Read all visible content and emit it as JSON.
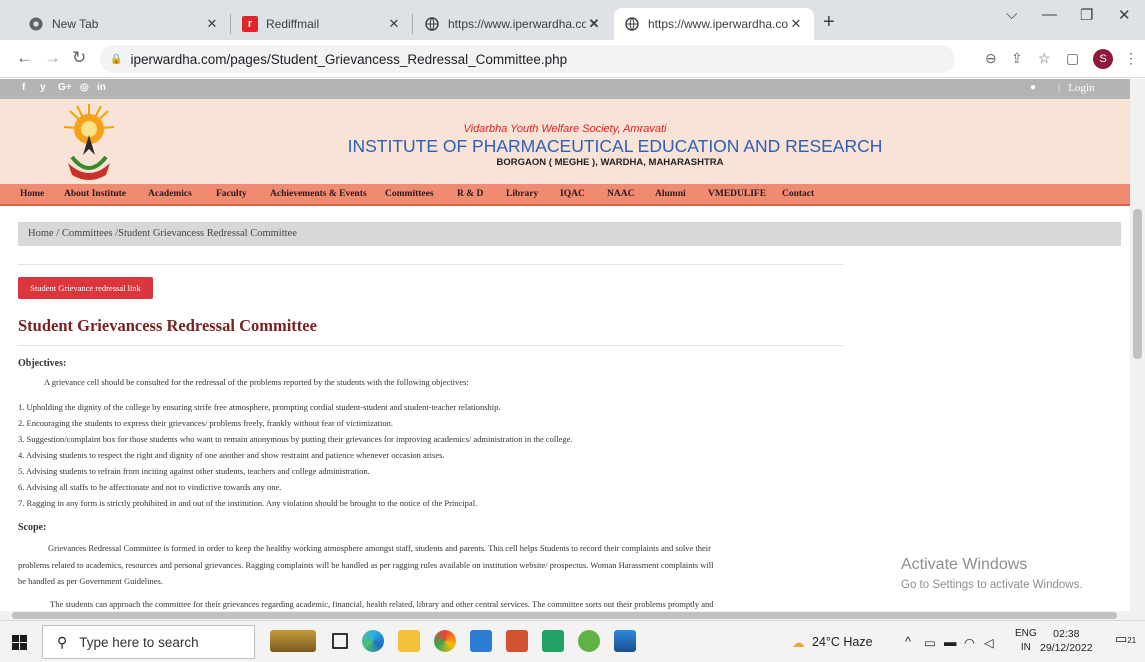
{
  "browser": {
    "tabs": [
      {
        "title": "New Tab",
        "icon": "chrome-icon"
      },
      {
        "title": "Rediffmail",
        "icon": "rediff-icon"
      },
      {
        "title": "https://www.iperwardha.com/pa",
        "icon": "globe-icon"
      },
      {
        "title": "https://www.iperwardha.com/pa",
        "icon": "globe-icon"
      }
    ],
    "new_tab": "+",
    "url": "iperwardha.com/pages/Student_Grievancess_Redressal_Committee.php"
  },
  "site": {
    "social": [
      "f",
      "y",
      "G+",
      "◎",
      "in"
    ],
    "login": "Login",
    "society": "Vidarbha Youth Welfare Society, Amravati",
    "institute": "INSTITUTE OF PHARMACEUTICAL EDUCATION AND RESEARCH",
    "location": "BORGAON ( MEGHE ), WARDHA, MAHARASHTRA",
    "menu": [
      "Home",
      "About Institute",
      "Academics",
      "Faculty",
      "Achievements & Events",
      "Committees",
      "R & D",
      "Library",
      "IQAC",
      "NAAC",
      "Alumni",
      "VMEDULIFE",
      "Contact"
    ],
    "breadcrumb": "Home  /  Committees  /Student Grievancess Redressal Committee",
    "link_button": "Student Grievance redressal link",
    "page_title": "Student Grievancess Redressal Committee",
    "objectives_heading": "Objectives:",
    "objectives_intro": "A grievance cell should be consulted for the redressal of the problems reported by the students with the following objectives:",
    "objectives": [
      "1. Upholding the dignity of the college by ensuring strife free atmosphere, prompting cordial student-student and student-teacher relationship.",
      "2. Encouraging the students to express their grievances/ problems freely, frankly without fear of victimization.",
      "3. Suggestion/complaint box for those students who want to remain anonymous by putting their grievances for improving academics/ administration in the college.",
      "4. Advising students to respect the right and dignity of one another and show restraint and patience whenever occasion arises.",
      "5. Advising students to refrain from inciting against other students, teachers and college administration.",
      "6. Advising all staffs to be affectionate and not to vindictive towards any one.",
      "7. Ragging in any form is strictly prohibited in and out of the institution. Any violation should be brought to the notice of the Principal."
    ],
    "scope_heading": "Scope:",
    "scope_lines": [
      "Grievances Redressal Committee is formed in order to keep the healthy working atmosphere amongst staff, students and parents. This cell helps Students to record their complaints and solve their",
      "problems related to academics, resources and personal grievances. Ragging complaints will be handled as per ragging rules available on institution website/ prospectus. Woman Harassment complaints will",
      "be handled as per Government Guidelines."
    ],
    "scope_last": "The students can approach the committee for their grievances regarding academic, financial, health related, library and other central services. The committee sorts out their problems promptly and"
  },
  "watermark": {
    "title": "Activate Windows",
    "subtitle": "Go to Settings to activate Windows."
  },
  "taskbar": {
    "search_placeholder": "Type here to search",
    "weather": "24°C  Haze",
    "lang_top": "ENG",
    "lang_bottom": "IN",
    "time": "02:38",
    "date": "29/12/2022",
    "notifications": "21"
  }
}
